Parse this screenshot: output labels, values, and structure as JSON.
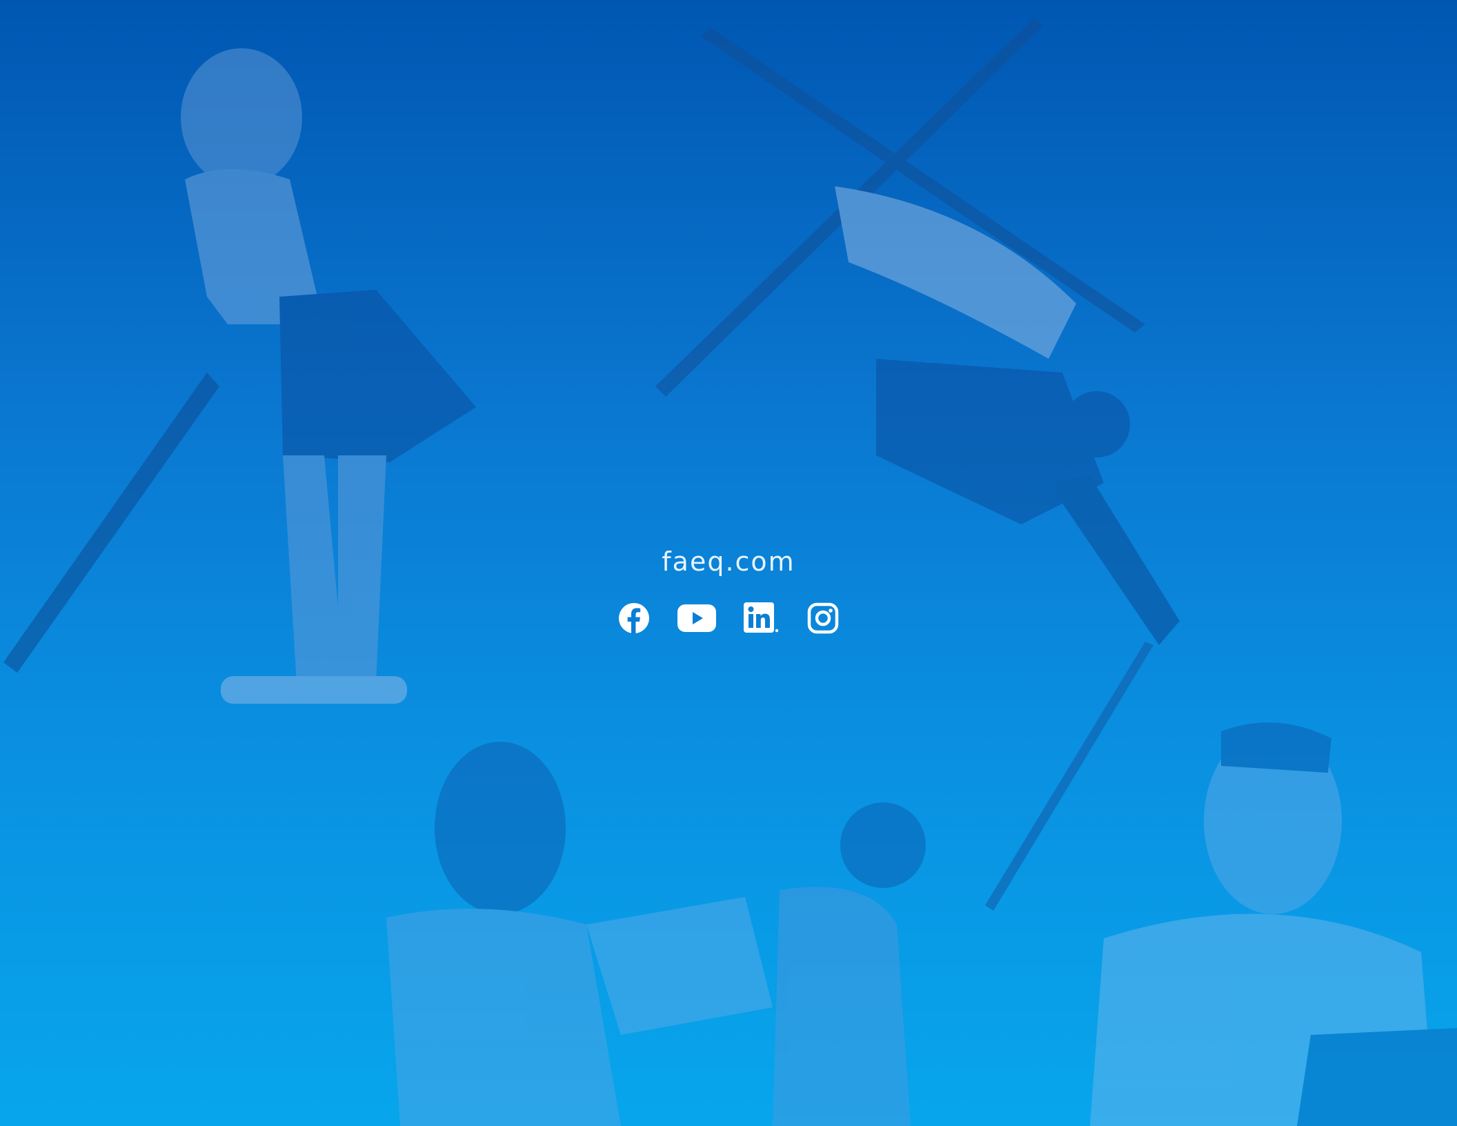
{
  "background": {
    "gradient_top": "#0057b2",
    "gradient_bottom": "#07a6ec",
    "image_subjects": [
      "golfer",
      "freestyle-skier",
      "taekwondo-athletes",
      "smiling-man"
    ]
  },
  "footer": {
    "url": "faeq.com",
    "text_color": "#e9f5ff",
    "social_links": [
      {
        "network": "facebook",
        "icon": "facebook-icon"
      },
      {
        "network": "youtube",
        "icon": "youtube-icon"
      },
      {
        "network": "linkedin",
        "icon": "linkedin-icon"
      },
      {
        "network": "instagram",
        "icon": "instagram-icon"
      }
    ]
  }
}
